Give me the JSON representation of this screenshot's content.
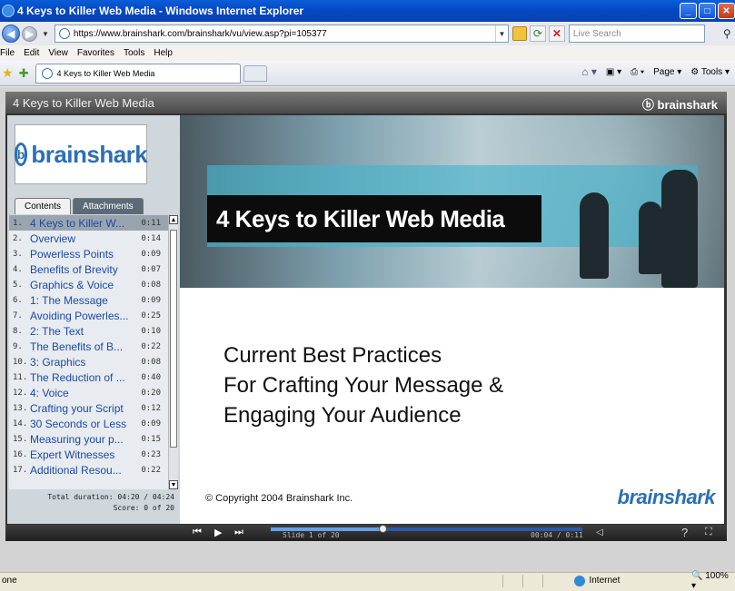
{
  "window": {
    "title": "4 Keys to Killer Web Media - Windows Internet Explorer",
    "minimize_icon": "minimize-icon",
    "maximize_icon": "maximize-icon",
    "close_icon": "close-icon"
  },
  "address_bar": {
    "url": "https://www.brainshark.com/brainshark/vu/view.asp?pi=105377",
    "search_placeholder": "Live Search"
  },
  "menu": [
    "File",
    "Edit",
    "View",
    "Favorites",
    "Tools",
    "Help"
  ],
  "tab": {
    "title": "4 Keys to Killer Web Media"
  },
  "command_bar": {
    "page_label": "Page",
    "tools_label": "Tools"
  },
  "player": {
    "title": "4 Keys to Killer Web Media",
    "brand": "brainshark",
    "logo_text": "brainshark",
    "tabs": [
      "Contents",
      "Attachments"
    ],
    "contents": [
      {
        "num": "1.",
        "label": "4 Keys to Killer W...",
        "dur": "0:11"
      },
      {
        "num": "2.",
        "label": "Overview",
        "dur": "0:14"
      },
      {
        "num": "3.",
        "label": "Powerless Points",
        "dur": "0:09"
      },
      {
        "num": "4.",
        "label": "Benefits of Brevity",
        "dur": "0:07"
      },
      {
        "num": "5.",
        "label": "Graphics & Voice",
        "dur": "0:08"
      },
      {
        "num": "6.",
        "label": "1: The Message",
        "dur": "0:09"
      },
      {
        "num": "7.",
        "label": "Avoiding Powerles...",
        "dur": "0:25"
      },
      {
        "num": "8.",
        "label": "2: The Text",
        "dur": "0:10"
      },
      {
        "num": "9.",
        "label": "The Benefits of B...",
        "dur": "0:22"
      },
      {
        "num": "10.",
        "label": "3: Graphics",
        "dur": "0:08"
      },
      {
        "num": "11.",
        "label": "The Reduction of ...",
        "dur": "0:40"
      },
      {
        "num": "12.",
        "label": "4: Voice",
        "dur": "0:20"
      },
      {
        "num": "13.",
        "label": "Crafting your Script",
        "dur": "0:12"
      },
      {
        "num": "14.",
        "label": "30 Seconds or Less",
        "dur": "0:09"
      },
      {
        "num": "15.",
        "label": "Measuring your p...",
        "dur": "0:15"
      },
      {
        "num": "16.",
        "label": "Expert Witnesses",
        "dur": "0:23"
      },
      {
        "num": "17.",
        "label": "Additional Resou...",
        "dur": "0:22"
      }
    ],
    "total_duration": "Total duration: 04:20 / 04:24",
    "score": "Score: 0 of 20",
    "slide": {
      "banner_title": "4 Keys to Killer Web Media",
      "subtitle_lines": [
        "Current Best Practices",
        "For Crafting Your Message &",
        "Engaging Your Audience"
      ],
      "copyright": "© Copyright 2004 Brainshark Inc.",
      "logo": "brainshark"
    },
    "controls": {
      "slide_label": "Slide 1 of 20",
      "time_label": "00:04 / 0:11",
      "progress_fraction": 0.36
    }
  },
  "status": {
    "text": "one",
    "zone": "Internet",
    "zoom": "100%"
  }
}
